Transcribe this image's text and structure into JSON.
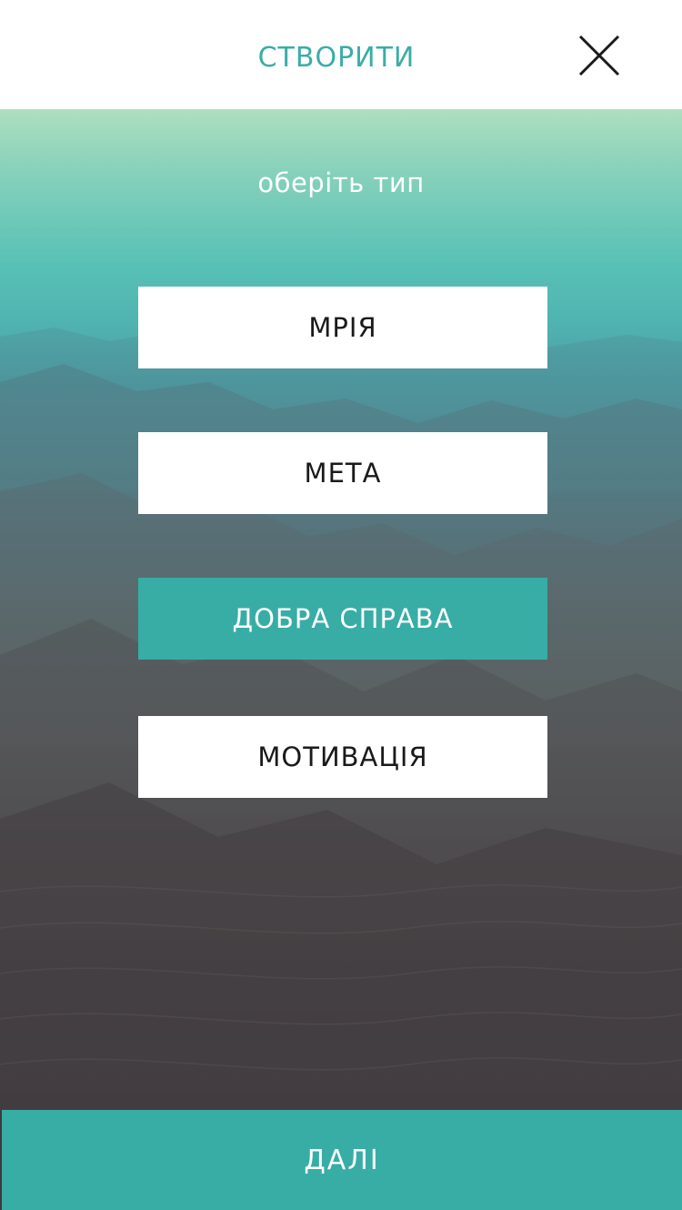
{
  "header": {
    "title": "СТВОРИТИ",
    "close_icon": "close-icon"
  },
  "main": {
    "subtitle": "оберіть тип",
    "types": [
      {
        "label": "МРІЯ",
        "selected": false
      },
      {
        "label": "МЕТА",
        "selected": false
      },
      {
        "label": "ДОБРА СПРАВА",
        "selected": true
      },
      {
        "label": "МОТИВАЦІЯ",
        "selected": false
      }
    ]
  },
  "footer": {
    "next_label": "ДАЛІ"
  },
  "colors": {
    "accent": "#37ada6",
    "title": "#3aada6",
    "background_top": "#aedfc0",
    "background_bottom": "#453f44"
  }
}
